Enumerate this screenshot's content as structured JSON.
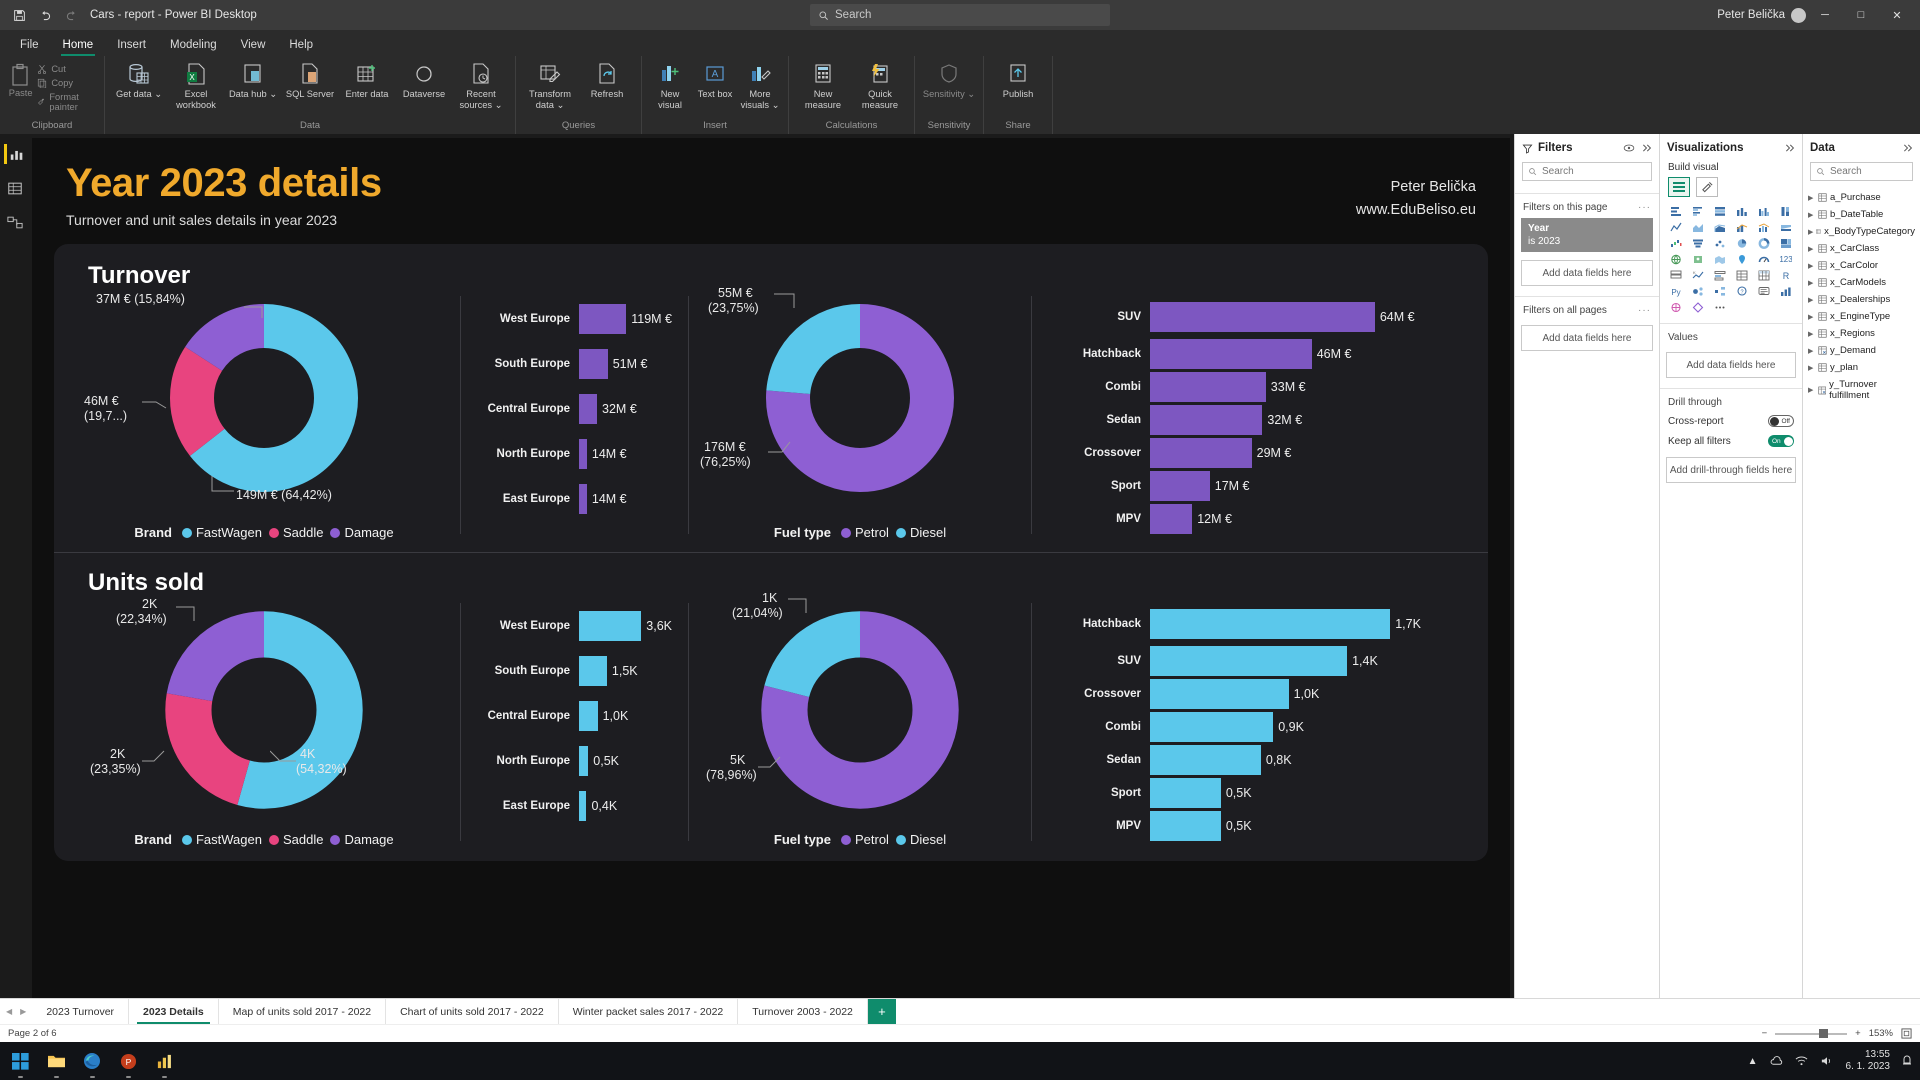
{
  "titlebar": {
    "save_icon": "save-icon",
    "undo_icon": "undo-icon",
    "redo_icon": "redo-icon",
    "title": "Cars - report - Power BI Desktop",
    "search_placeholder": "Search",
    "user": "Peter Belička",
    "minimize": "─",
    "maximize": "□",
    "close": "✕"
  },
  "menu": [
    {
      "label": "File",
      "active": false
    },
    {
      "label": "Home",
      "active": true
    },
    {
      "label": "Insert",
      "active": false
    },
    {
      "label": "Modeling",
      "active": false
    },
    {
      "label": "View",
      "active": false
    },
    {
      "label": "Help",
      "active": false
    }
  ],
  "ribbon": {
    "groups": [
      {
        "name": "Clipboard",
        "paste": "Paste",
        "cut": "Cut",
        "copy": "Copy",
        "format_painter": "Format painter"
      },
      {
        "name": "Data",
        "items": [
          "Get\ndata ⌄",
          "Excel\nworkbook",
          "Data\nhub ⌄",
          "SQL\nServer",
          "Enter\ndata",
          "Dataverse",
          "Recent\nsources ⌄"
        ]
      },
      {
        "name": "Queries",
        "items": [
          "Transform\ndata ⌄",
          "Refresh"
        ]
      },
      {
        "name": "Insert",
        "items": [
          "New\nvisual",
          "Text\nbox",
          "More\nvisuals ⌄"
        ]
      },
      {
        "name": "Calculations",
        "items": [
          "New\nmeasure",
          "Quick\nmeasure"
        ]
      },
      {
        "name": "Sensitivity",
        "items": [
          "Sensitivity\n⌄"
        ]
      },
      {
        "name": "Share",
        "items": [
          "Publish"
        ]
      }
    ]
  },
  "report": {
    "title": "Year 2023 details",
    "subtitle": "Turnover and unit sales details in year 2023",
    "author": "Peter Belička",
    "website": "www.EduBeliso.eu"
  },
  "chart_data": [
    {
      "type": "pie",
      "title": "Turnover",
      "legend_title": "Brand",
      "legend_position": "bottom",
      "labels": [
        "FastWagen",
        "Saddle",
        "Damage"
      ],
      "values": [
        149,
        46,
        37
      ],
      "unit": "M €",
      "percents": [
        64.42,
        19.74,
        15.84
      ],
      "data_labels": [
        "149M € (64,42%)",
        "46M €\n(19,7...)",
        "37M € (15,84%)"
      ],
      "label_0": "149M € (64,42%)",
      "label_1a": "46M €",
      "label_1b": "(19,7...)",
      "label_2": "37M € (15,84%)",
      "colors": [
        "#5bc8eb",
        "#e8447f",
        "#8e5fd3"
      ]
    },
    {
      "type": "bar",
      "title": "Turnover by region",
      "orientation": "horizontal",
      "categories": [
        "West Europe",
        "South Europe",
        "Central Europe",
        "North Europe",
        "East Europe"
      ],
      "values": [
        119,
        51,
        32,
        14,
        14
      ],
      "value_labels": [
        "119M €",
        "51M €",
        "32M €",
        "14M €",
        "14M €"
      ],
      "color": "#7d57c1",
      "xlabel": "",
      "ylabel": ""
    },
    {
      "type": "pie",
      "title": "Turnover by fuel type",
      "legend_title": "Fuel type",
      "legend_position": "bottom",
      "labels": [
        "Petrol",
        "Diesel"
      ],
      "values": [
        176,
        55
      ],
      "unit": "M €",
      "percents": [
        76.25,
        23.75
      ],
      "label_0a": "176M €",
      "label_0b": "(76,25%)",
      "label_1a": "55M €",
      "label_1b": "(23,75%)",
      "colors": [
        "#8e5fd3",
        "#5bc8eb"
      ]
    },
    {
      "type": "bar",
      "title": "Turnover by car class",
      "orientation": "horizontal",
      "categories": [
        "SUV",
        "Hatchback",
        "Combi",
        "Sedan",
        "Crossover",
        "Sport",
        "MPV"
      ],
      "values": [
        64,
        46,
        33,
        32,
        29,
        17,
        12
      ],
      "value_labels": [
        "64M €",
        "46M €",
        "33M €",
        "32M €",
        "29M €",
        "17M €",
        "12M €"
      ],
      "color": "#7d57c1",
      "xlabel": "",
      "ylabel": ""
    },
    {
      "type": "pie",
      "title": "Units sold",
      "legend_title": "Brand",
      "legend_position": "bottom",
      "labels": [
        "FastWagen",
        "Saddle",
        "Damage"
      ],
      "values": [
        4,
        2,
        2
      ],
      "unit": "K",
      "percents": [
        54.32,
        23.35,
        22.34
      ],
      "label_0a": "4K",
      "label_0b": "(54,32%)",
      "label_1a": "2K",
      "label_1b": "(23,35%)",
      "label_2a": "2K",
      "label_2b": "(22,34%)",
      "colors": [
        "#5bc8eb",
        "#e8447f",
        "#8e5fd3"
      ]
    },
    {
      "type": "bar",
      "title": "Units sold by region",
      "orientation": "horizontal",
      "categories": [
        "West Europe",
        "South Europe",
        "Central Europe",
        "North Europe",
        "East Europe"
      ],
      "values": [
        3.6,
        1.5,
        1.0,
        0.5,
        0.4
      ],
      "value_labels": [
        "3,6K",
        "1,5K",
        "1,0K",
        "0,5K",
        "0,4K"
      ],
      "color": "#5bc8eb",
      "xlabel": "",
      "ylabel": ""
    },
    {
      "type": "pie",
      "title": "Units sold by fuel type",
      "legend_title": "Fuel type",
      "legend_position": "bottom",
      "labels": [
        "Petrol",
        "Diesel"
      ],
      "values": [
        5,
        1
      ],
      "unit": "K",
      "percents": [
        78.96,
        21.04
      ],
      "label_0a": "5K",
      "label_0b": "(78,96%)",
      "label_1a": "1K",
      "label_1b": "(21,04%)",
      "colors": [
        "#8e5fd3",
        "#5bc8eb"
      ]
    },
    {
      "type": "bar",
      "title": "Units sold by car class",
      "orientation": "horizontal",
      "categories": [
        "Hatchback",
        "SUV",
        "Crossover",
        "Combi",
        "Sedan",
        "Sport",
        "MPV"
      ],
      "values": [
        1.7,
        1.4,
        1.0,
        0.9,
        0.8,
        0.5,
        0.5
      ],
      "value_labels": [
        "1,7K",
        "1,4K",
        "1,0K",
        "0,9K",
        "0,8K",
        "0,5K",
        "0,5K"
      ],
      "color": "#5bc8eb",
      "xlabel": "",
      "ylabel": ""
    }
  ],
  "sections": {
    "turnover": "Turnover",
    "units": "Units sold"
  },
  "legends": {
    "brand_title": "Brand",
    "brand_items": [
      "FastWagen",
      "Saddle",
      "Damage"
    ],
    "fuel_title": "Fuel type",
    "fuel_items": [
      "Petrol",
      "Diesel"
    ]
  },
  "filters_pane": {
    "title": "Filters",
    "search_placeholder": "Search",
    "section_page": "Filters on this page",
    "section_all": "Filters on all pages",
    "dots": "···",
    "card_name": "Year",
    "card_value": "is 2023",
    "dropzone": "Add data fields here"
  },
  "vis_pane": {
    "title": "Visualizations",
    "build_label": "Build visual",
    "values_label": "Values",
    "values_drop": "Add data fields here",
    "drill_label": "Drill through",
    "crossreport_label": "Cross-report",
    "crossreport_state": "Off",
    "keepfilters_label": "Keep all filters",
    "keepfilters_state": "On",
    "drill_drop": "Add drill-through fields here"
  },
  "data_pane": {
    "title": "Data",
    "search_placeholder": "Search",
    "tables": [
      "a_Purchase",
      "b_DateTable",
      "x_BodyTypeCategory",
      "x_CarClass",
      "x_CarColor",
      "x_CarModels",
      "x_Dealerships",
      "x_EngineType",
      "x_Regions",
      "y_Demand",
      "y_plan",
      "y_Turnover fulfillment"
    ]
  },
  "page_tabs": [
    {
      "label": "2023 Turnover",
      "active": false
    },
    {
      "label": "2023 Details",
      "active": true
    },
    {
      "label": "Map of units sold 2017 - 2022",
      "active": false
    },
    {
      "label": "Chart of units sold 2017 - 2022",
      "active": false
    },
    {
      "label": "Winter packet sales 2017 - 2022",
      "active": false
    },
    {
      "label": "Turnover 2003 - 2022",
      "active": false
    }
  ],
  "add_tab": "+",
  "statusbar": {
    "page_indicator": "Page 2 of 6",
    "zoom": "153%",
    "minus": "−",
    "plus": "+"
  },
  "taskbar": {
    "time": "13:55",
    "date": "6. 1. 2023"
  }
}
